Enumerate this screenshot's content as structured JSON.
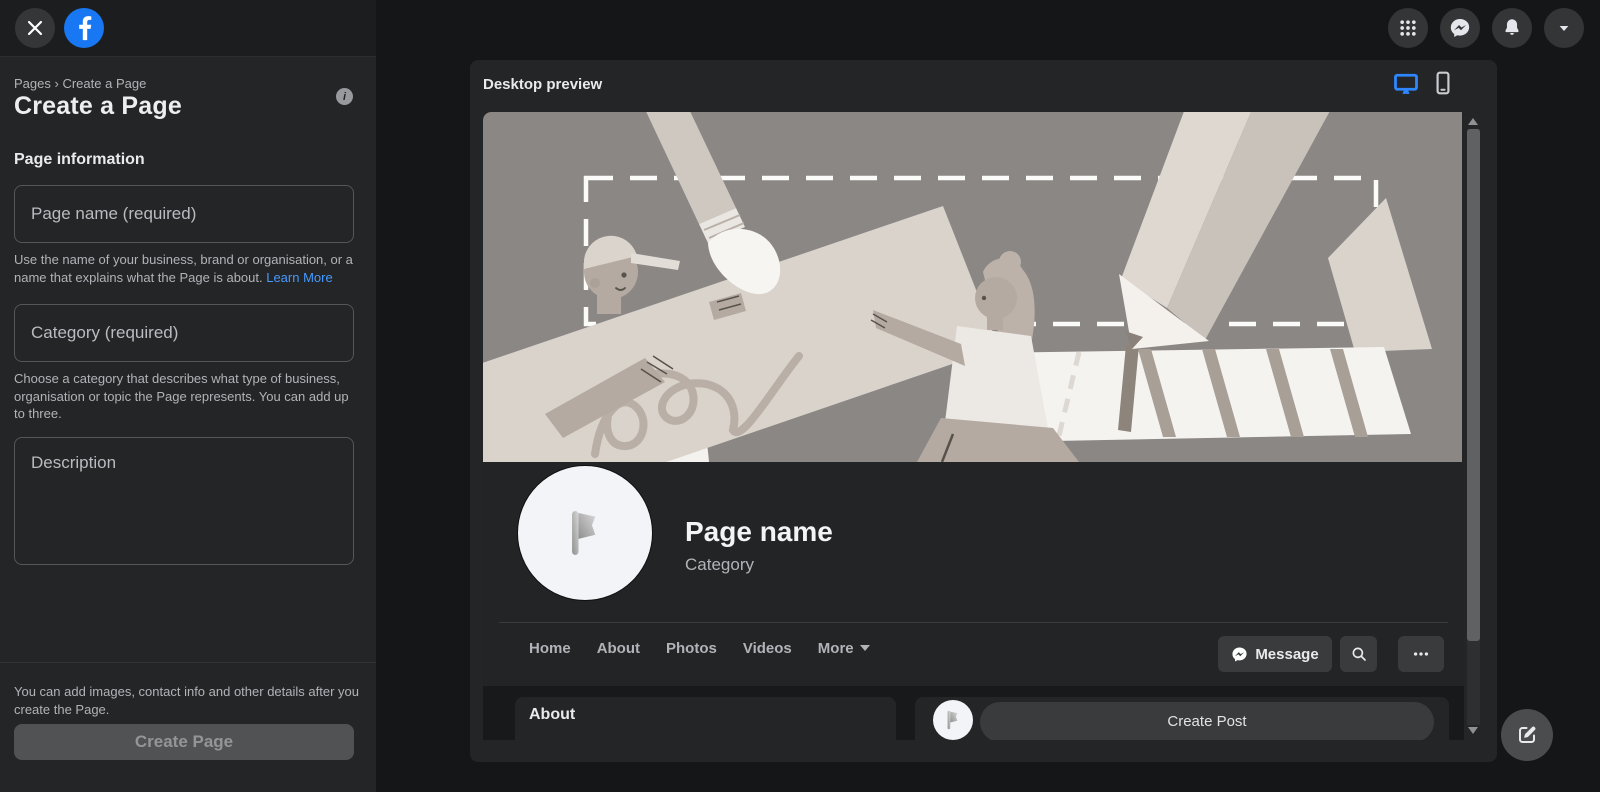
{
  "topbar": {
    "icons": [
      "close-icon",
      "facebook-logo",
      "apps-grid-icon",
      "messenger-icon",
      "notifications-icon",
      "account-menu-icon"
    ]
  },
  "sidebar": {
    "breadcrumb": [
      "Pages",
      "Create a Page"
    ],
    "breadcrumb_separator": "›",
    "title": "Create a Page",
    "info_glyph": "i",
    "section_heading": "Page information",
    "page_name_field": {
      "placeholder": "Page name (required)",
      "value": ""
    },
    "page_name_help": {
      "text": "Use the name of your business, brand or organisation, or a name that explains what the Page is about. ",
      "link": "Learn More"
    },
    "category_field": {
      "placeholder": "Category (required)",
      "value": ""
    },
    "category_help": "Choose a category that describes what type of business, organisation or topic the Page represents. You can add up to three.",
    "description_field": {
      "placeholder": "Description",
      "value": ""
    },
    "footer_note": "You can add images, contact info and other details after you create the Page.",
    "create_button": {
      "label": "Create Page",
      "enabled": false
    }
  },
  "preview": {
    "title": "Desktop preview",
    "device_toggle": [
      "desktop",
      "mobile"
    ],
    "page_name": "Page name",
    "category": "Category",
    "tabs": [
      "Home",
      "About",
      "Photos",
      "Videos"
    ],
    "more_label": "More",
    "message_label": "Message",
    "about_label": "About",
    "create_post_label": "Create Post"
  },
  "colors": {
    "facebook_blue": "#1877f2",
    "accent_blue": "#2e87ff",
    "link_blue": "#4599ff",
    "panel_bg": "#242526",
    "page_bg": "#151617",
    "cover_gray": "#8b8784"
  }
}
